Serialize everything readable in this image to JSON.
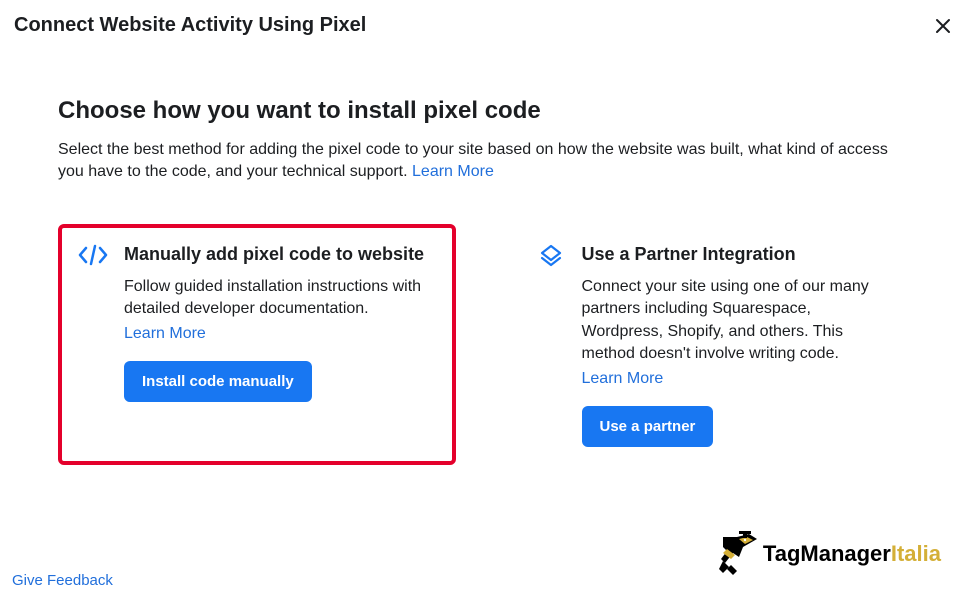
{
  "header": {
    "title": "Connect Website Activity Using Pixel"
  },
  "main": {
    "heading": "Choose how you want to install pixel code",
    "description": "Select the best method for adding the pixel code to your site based on how the website was built, what kind of access you have to the code, and your technical support. ",
    "learn_more": "Learn More"
  },
  "options": {
    "manual": {
      "title": "Manually add pixel code to website",
      "description": "Follow guided installation instructions with detailed developer documentation.",
      "learn_more": "Learn More",
      "button": "Install code manually"
    },
    "partner": {
      "title": "Use a Partner Integration",
      "description": "Connect your site using one of our many partners including Squarespace, Wordpress, Shopify, and others. This method doesn't involve writing code.",
      "learn_more": "Learn More",
      "button": "Use a partner"
    }
  },
  "footer": {
    "feedback": "Give Feedback"
  },
  "brand": {
    "prefix": "TagManager",
    "suffix": "Italia"
  }
}
